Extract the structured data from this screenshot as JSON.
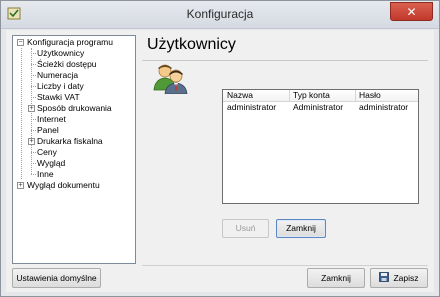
{
  "window": {
    "title": "Konfiguracja",
    "close_glyph": "✕"
  },
  "tree": {
    "items": [
      {
        "label": "Konfiguracja programu",
        "expander": "⊟"
      },
      {
        "label": "Użytkownicy"
      },
      {
        "label": "Ścieżki dostępu"
      },
      {
        "label": "Numeracja"
      },
      {
        "label": "Liczby i daty"
      },
      {
        "label": "Stawki VAT"
      },
      {
        "label": "Sposób drukowania",
        "expander": "+"
      },
      {
        "label": "Internet"
      },
      {
        "label": "Panel"
      },
      {
        "label": "Drukarka fiskalna",
        "expander": "+"
      },
      {
        "label": "Ceny"
      },
      {
        "label": "Wygląd"
      },
      {
        "label": "Inne"
      },
      {
        "label": "Wygląd dokumentu",
        "expander": "+"
      }
    ]
  },
  "panel": {
    "title": "Użytkownicy",
    "grid": {
      "columns": [
        "Nazwa",
        "Typ konta",
        "Hasło"
      ],
      "rows": [
        [
          "administrator",
          "Administrator",
          "administrator"
        ]
      ]
    },
    "delete_label": "Usuń",
    "close_label": "Zamknij"
  },
  "footer": {
    "defaults_label": "Ustawienia domyślne",
    "close_label": "Zamknij",
    "save_label": "Zapisz"
  }
}
